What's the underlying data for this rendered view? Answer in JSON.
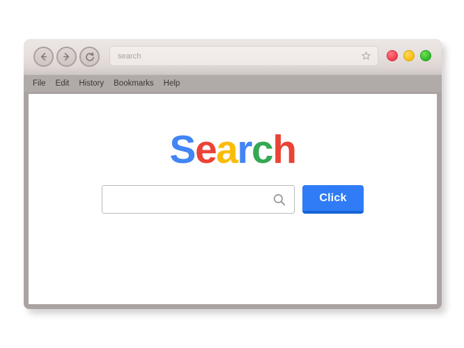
{
  "browser": {
    "nav": {
      "back_label": "Back",
      "back_icon": "arrow-left-circle-icon",
      "forward_label": "Forward",
      "forward_icon": "arrow-right-circle-icon",
      "reload_label": "Reload",
      "reload_icon": "reload-circle-icon"
    },
    "address_bar": {
      "value": "search",
      "placeholder": "search",
      "bookmark_icon": "star-icon"
    },
    "window_controls": {
      "close_label": "Close",
      "minimize_label": "Minimize",
      "maximize_label": "Maximize",
      "close_color": "#ef3d4e",
      "minimize_color": "#fcbe0a",
      "maximize_color": "#2db92a"
    },
    "menubar": {
      "items": [
        {
          "label": "File"
        },
        {
          "label": "Edit"
        },
        {
          "label": "History"
        },
        {
          "label": "Bookmarks"
        },
        {
          "label": "Help"
        }
      ]
    }
  },
  "page": {
    "logo": {
      "text": "Search",
      "letters": [
        {
          "char": "S",
          "color": "#4285F4"
        },
        {
          "char": "e",
          "color": "#EA4335"
        },
        {
          "char": "a",
          "color": "#FBBC05"
        },
        {
          "char": "r",
          "color": "#4285F4"
        },
        {
          "char": "c",
          "color": "#34A853"
        },
        {
          "char": "h",
          "color": "#EA4335"
        }
      ]
    },
    "search": {
      "value": "",
      "placeholder": "",
      "icon": "magnifier-icon"
    },
    "submit_button": {
      "label": "Click",
      "color": "#2f7cf6",
      "shadow_color": "#1663d6"
    }
  }
}
